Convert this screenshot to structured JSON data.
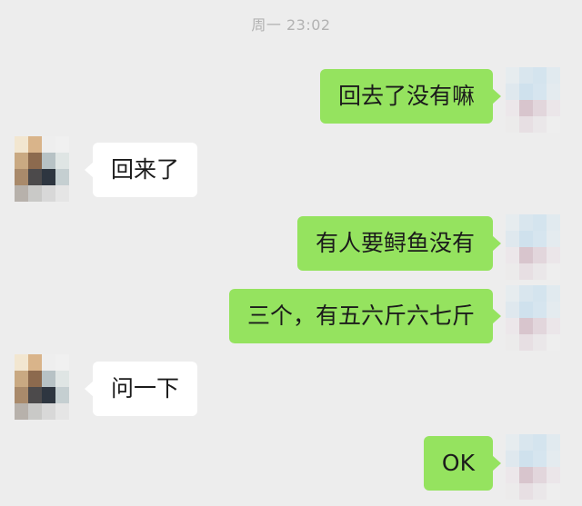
{
  "timestamp": "周一 23:02",
  "messages": [
    {
      "sender": "self",
      "text": "回去了没有嘛"
    },
    {
      "sender": "other",
      "text": "回来了"
    },
    {
      "sender": "self",
      "text": "有人要鲟鱼没有"
    },
    {
      "sender": "self",
      "text": "三个，有五六斤六七斤"
    },
    {
      "sender": "other",
      "text": "问一下"
    },
    {
      "sender": "self",
      "text": "OK"
    }
  ],
  "colors": {
    "background": "#ededed",
    "sent_bubble": "#95e35f",
    "received_bubble": "#ffffff",
    "timestamp_text": "#b2b2b2"
  }
}
